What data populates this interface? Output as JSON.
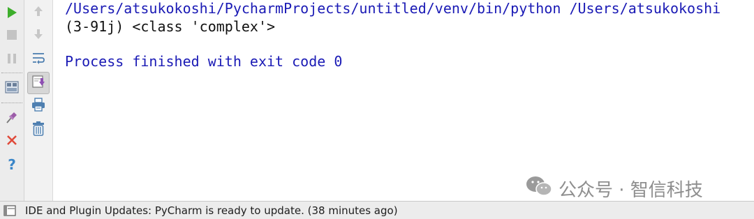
{
  "console": {
    "command_line": "/Users/atsukokoshi/PycharmProjects/untitled/venv/bin/python /Users/atsukokoshi",
    "output_line": "(3-91j) <class 'complex'>",
    "exit_message": "Process finished with exit code 0"
  },
  "left_toolbar": {
    "buttons": [
      {
        "icon": "run-icon",
        "color": "#3dae2b"
      },
      {
        "icon": "stop-icon",
        "color": "#c3c3c3"
      },
      {
        "icon": "pause-icon",
        "color": "#c3c3c3"
      },
      {
        "icon": "layout-icon",
        "color": "#6b7f9a"
      },
      {
        "icon": "pin-icon",
        "color": "#9b5ca8"
      },
      {
        "icon": "close-icon",
        "color": "#e04a3a"
      },
      {
        "icon": "help-icon",
        "color": "#3a86c8"
      }
    ]
  },
  "second_toolbar": {
    "buttons": [
      {
        "icon": "arrow-up-icon"
      },
      {
        "icon": "arrow-down-icon"
      },
      {
        "icon": "soft-wrap-icon"
      },
      {
        "icon": "scroll-to-end-icon"
      },
      {
        "icon": "print-icon"
      },
      {
        "icon": "trash-icon"
      }
    ]
  },
  "watermark": {
    "text": "公众号 · 智信科技"
  },
  "statusbar": {
    "message": "IDE and Plugin Updates: PyCharm is ready to update. (38 minutes ago)"
  }
}
